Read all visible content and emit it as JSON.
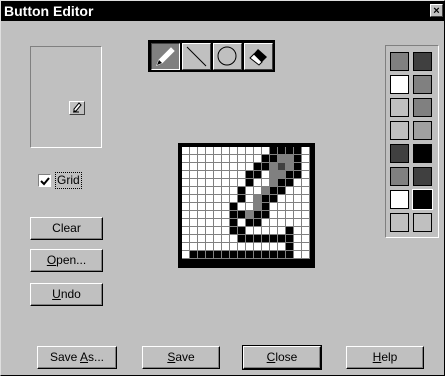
{
  "window": {
    "title": "Button Editor",
    "close_glyph": "×"
  },
  "preview": {
    "icon": "pencil-icon"
  },
  "grid_toggle": {
    "label": "Grid",
    "checked": true
  },
  "side_buttons": {
    "clear": "Clear",
    "open": "Open...",
    "undo": "Undo"
  },
  "tools": [
    {
      "name": "pencil-tool",
      "icon": "pencil-icon",
      "active": true
    },
    {
      "name": "line-tool",
      "icon": "line-icon",
      "active": false
    },
    {
      "name": "ellipse-tool",
      "icon": "circle-icon",
      "active": false
    },
    {
      "name": "eraser-tool",
      "icon": "eraser-icon",
      "active": false
    }
  ],
  "palette": {
    "colors_left": [
      "#808080",
      "#ffffff",
      "#c0c0c0",
      "#c0c0c0",
      "#404040",
      "#808080",
      "#ffffff",
      "#c0c0c0"
    ],
    "colors_right": [
      "#404040",
      "#808080",
      "#808080",
      "#a0a0a0",
      "#000000",
      "#404040",
      "#000000",
      "#c0c0c0"
    ]
  },
  "bitmap": {
    "rows": [
      "WWWWWWWWWWWBBBBW",
      "WWWWWWWWWWBBGGBW",
      "WWWWWWWWWBBGDGBW",
      "WWWWWWWWBB1GGBBW",
      "WWWWWWWWB11GBBWW",
      "WWWWWWWB11GBBWWW",
      "WWWWWWWB1GBBWWWW",
      "WWWWWWB11GBWWWWW",
      "WWWWWWBBGBBWWWWW",
      "WWWWWWBWBBWWWWWW",
      "WWWWWWBBWWWWWBWW",
      "WWWWWWWBBBBBBBWW",
      "WWWWWWWWWWWWWBWW",
      "WBBBBBBBBBBBBBWW"
    ]
  },
  "bottom_buttons": {
    "save_as": "Save As...",
    "save": "Save",
    "close": "Close",
    "help": "Help"
  }
}
